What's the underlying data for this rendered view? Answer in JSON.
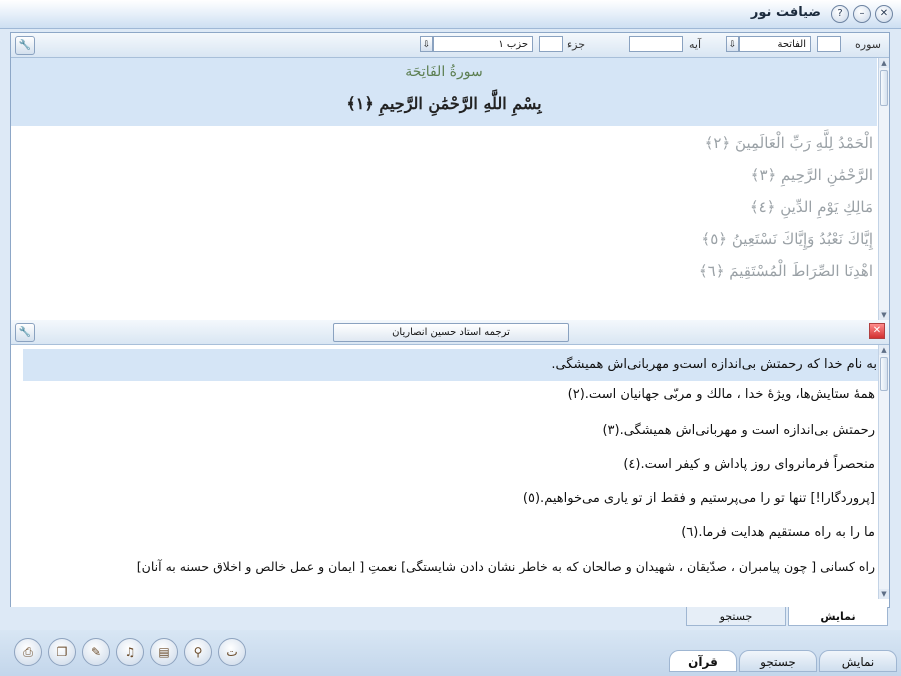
{
  "window": {
    "title": "ضیافت نور",
    "close_glyph": "✕",
    "minimize_glyph": "–",
    "help_glyph": "?"
  },
  "quran_toolbar": {
    "surah_label": "سوره",
    "surah_value": "الفاتحة",
    "ayah_label": "آیه",
    "juz_label": "جزء",
    "hizb_value": "حزب ۱"
  },
  "quran": {
    "surah_title": "سورةُ الفَاتِحَة",
    "basmala": "بِسْمِ اللَّهِ الرَّحْمَٰنِ الرَّحِيمِ ﴿١﴾",
    "verses": [
      "الْحَمْدُ لِلَّهِ رَبِّ الْعَالَمِينَ ﴿٢﴾",
      "الرَّحْمَٰنِ الرَّحِيمِ ﴿٣﴾",
      "مَالِكِ يَوْمِ الدِّينِ ﴿٤﴾",
      "إِيَّاكَ نَعْبُدُ وَإِيَّاكَ نَسْتَعِينُ ﴿٥﴾",
      "اهْدِنَا الصِّرَاطَ الْمُسْتَقِيمَ ﴿٦﴾"
    ]
  },
  "translation": {
    "title": "ترجمه استاد حسين انصاريان",
    "lines": [
      "به نام خدا كه رحمتش بی‌اندازه است‌و مهربانی‌اش هميشگی.",
      "همهٔ ستايش‌ها، ويژهٔ خدا ، مالك و مربّی جهانيان است.(٢)",
      "رحمتش بی‌اندازه است و مهربانی‌اش هميشگی.(٣)",
      "منحصراً فرمانروای روز پاداش و كيفر است.(٤)",
      "[پروردگارا!] تنها تو را می‌پرستيم و فقط از تو ياری می‌خواهيم.(٥)",
      "ما را به راه مستقيم هدايت فرما.(٦)",
      "راه كسانی [ چون پيامبران ، صدّيقان ، شهيدان و صالحان كه به خاطر نشان دادن شايستگی] نعمتِ [ ايمان و عمل خالص و اخلاق حسنه به آنان]"
    ]
  },
  "subtabs": {
    "show": "نمايش",
    "search": "جستجو"
  },
  "main_tabs": {
    "show": "نمايش",
    "search": "جستجو",
    "quran": "قرآن"
  }
}
